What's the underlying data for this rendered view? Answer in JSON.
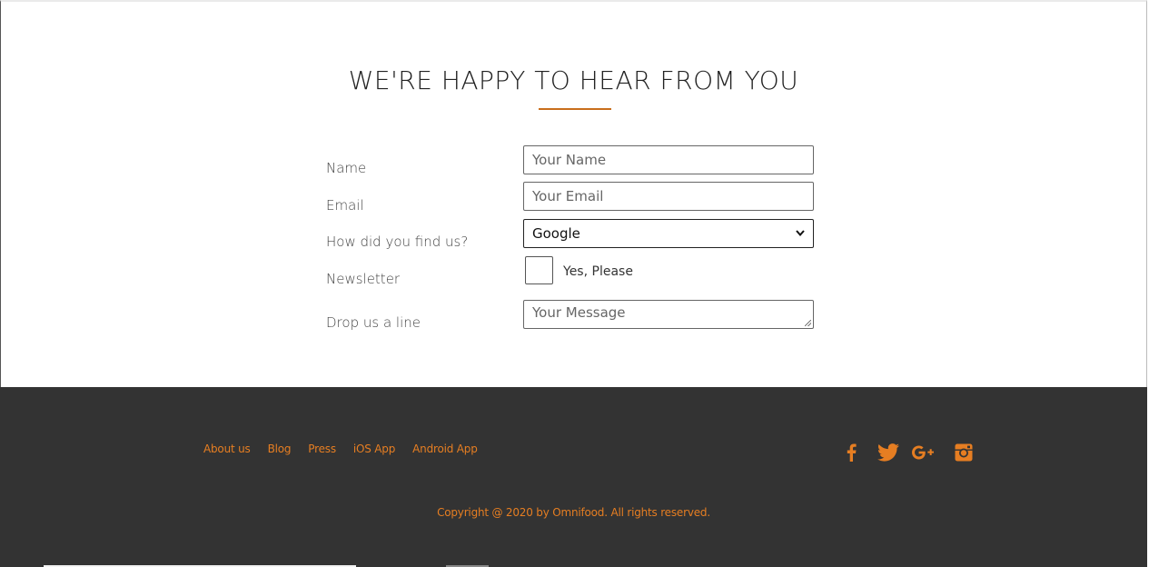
{
  "form": {
    "heading": "WE'RE HAPPY TO HEAR FROM YOU",
    "labels": {
      "name": "Name",
      "email": "Email",
      "find": "How did you find us?",
      "newsletter": "Newsletter",
      "message": "Drop us a line"
    },
    "name_placeholder": "Your Name",
    "email_placeholder": "Your Email",
    "find_selected": "Google",
    "newsletter_label": "Yes, Please",
    "newsletter_checked": false,
    "message_placeholder": "Your Message"
  },
  "footer": {
    "nav": [
      "About us",
      "Blog",
      "Press",
      "iOS App",
      "Android App"
    ],
    "social_icons": [
      "facebook-icon",
      "twitter-icon",
      "google-plus-icon",
      "instagram-icon"
    ],
    "copyright": "Copyright @ 2020 by Omnifood. All rights reserved."
  },
  "colors": {
    "accent": "#e67e22",
    "footer_bg": "#333333",
    "heading_rule": "#c96e1c"
  }
}
